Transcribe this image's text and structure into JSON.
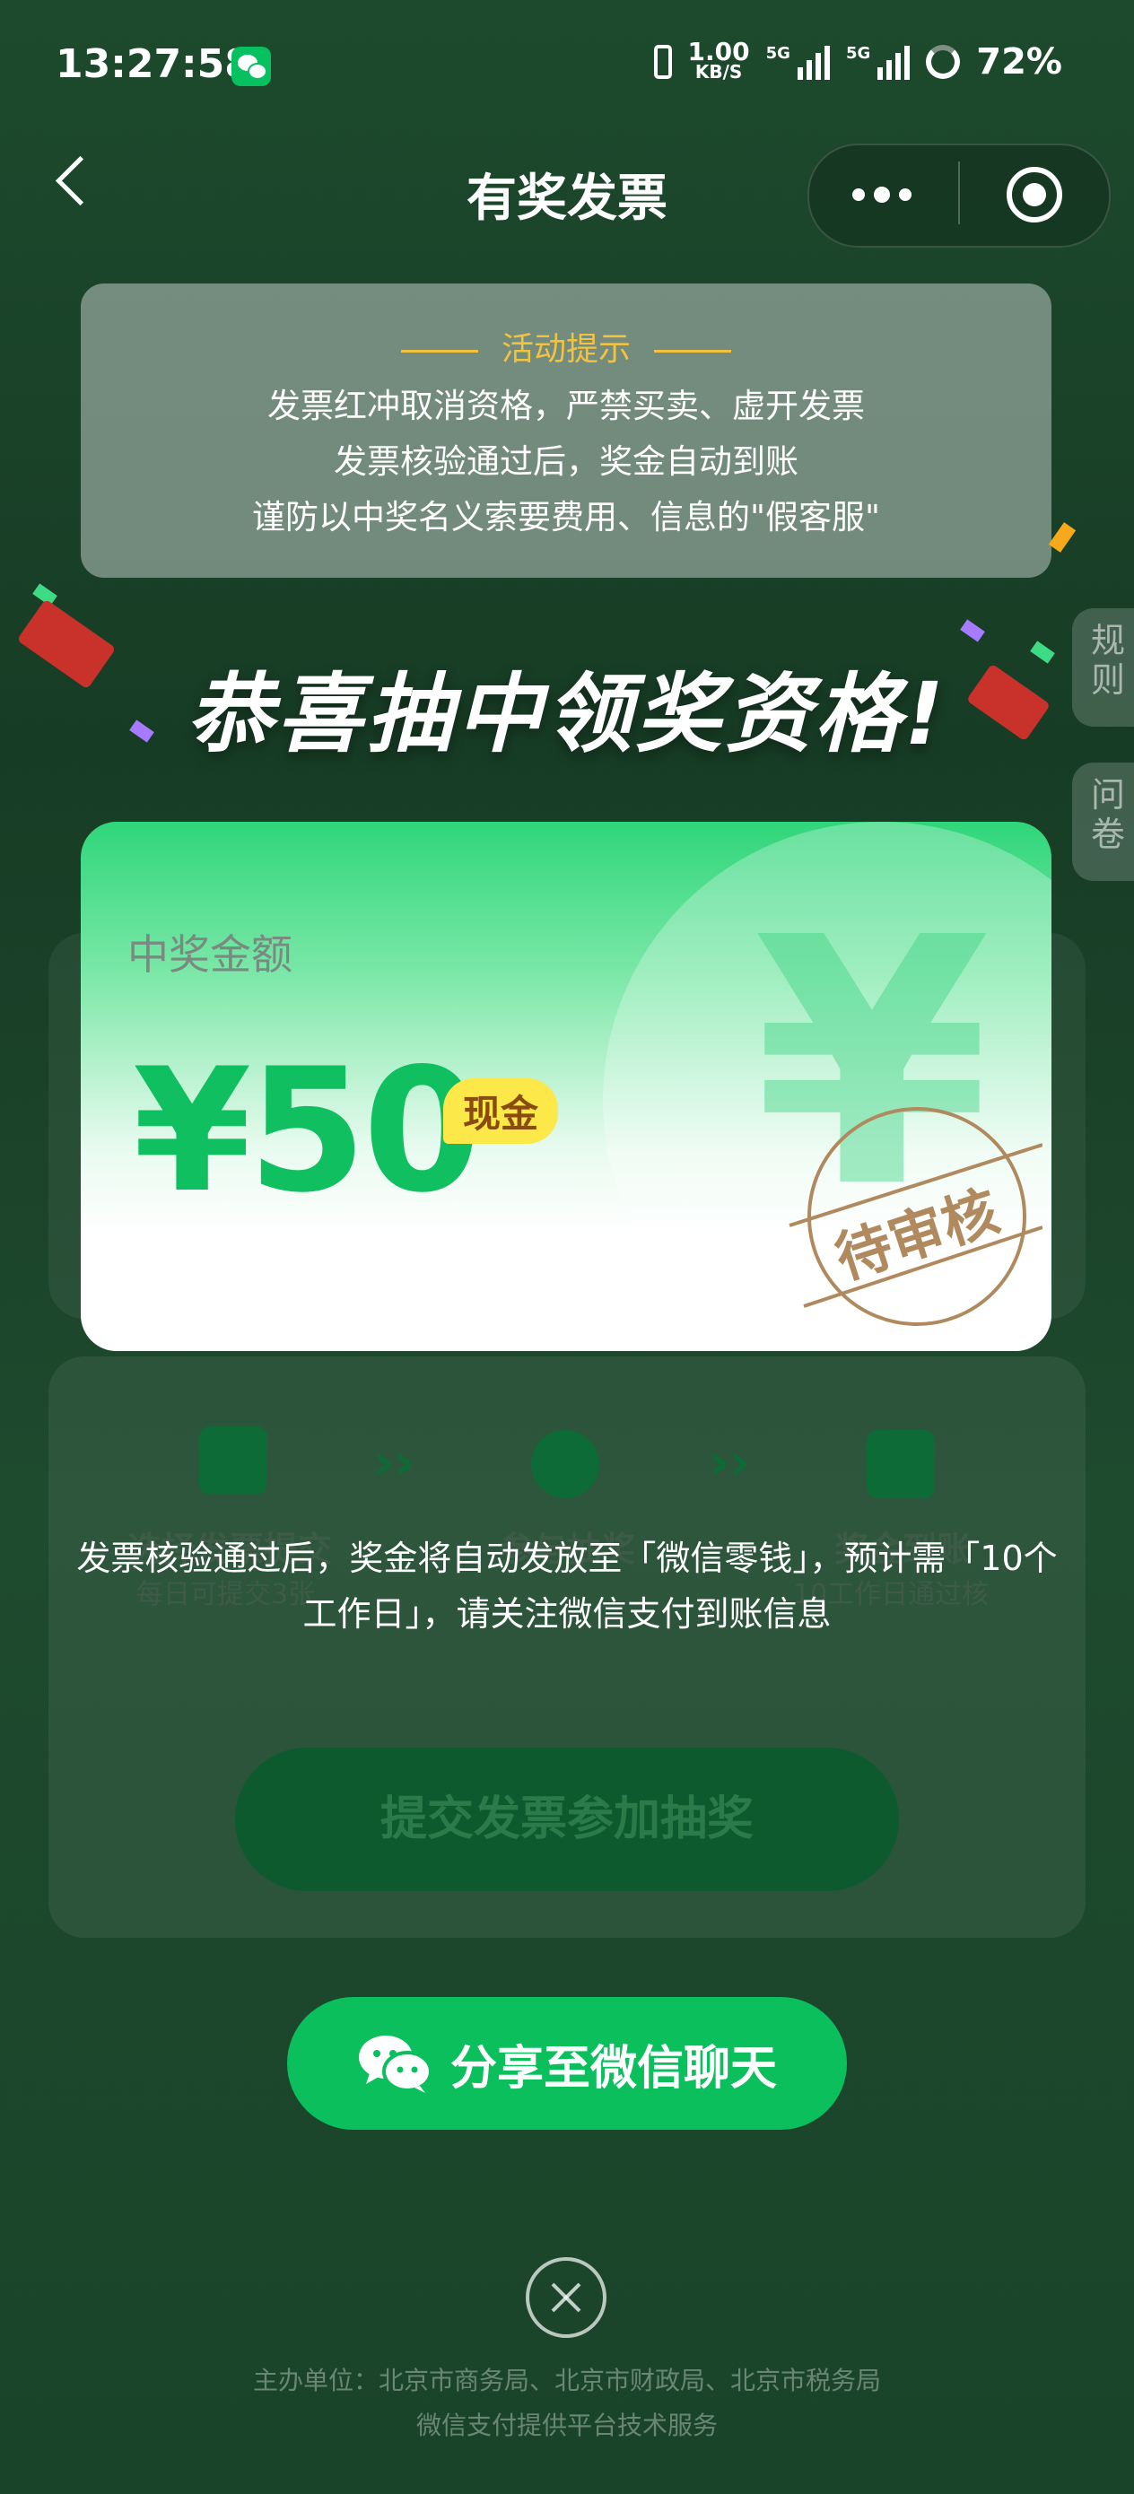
{
  "status_bar": {
    "time": "13:27:58",
    "net_rate_value": "1.00",
    "net_rate_unit": "KB/S",
    "signal_1": "5G",
    "signal_2": "5G",
    "battery": "72%"
  },
  "nav": {
    "title": "有奖发票"
  },
  "notice": {
    "heading": "活动提示",
    "lines": [
      "发票红冲取消资格，严禁买卖、虚开发票",
      "发票核验通过后，奖金自动到账",
      "谨防以中奖名义索要费用、信息的\"假客服\""
    ]
  },
  "side_tabs": [
    "规则",
    "问卷"
  ],
  "congrats": "恭喜抽中领奖资格!",
  "prize_card": {
    "label": "中奖金额",
    "amount": "¥50",
    "cash_tag": "现金",
    "stamp": "待审核",
    "bg_symbol": "¥"
  },
  "steps": [
    {
      "title": "选择发票提交",
      "sub": "每日可提交3张"
    },
    {
      "title": "参与抽奖",
      "sub": ""
    },
    {
      "title": "奖金到账",
      "sub": "10工作日通过核"
    }
  ],
  "toast": "发票核验通过后，奖金将自动发放至「微信零钱」，预计需「10个工作日」，请关注微信支付到账信息",
  "submit_button": "提交发票参加抽奖",
  "share_button": "分享至微信聊天",
  "footer": {
    "line1": "主办单位：北京市商务局、北京市财政局、北京市税务局",
    "line2": "微信支付提供平台技术服务"
  },
  "colors": {
    "accent": "#07c160",
    "prize_green": "#0fbf60",
    "notice_gold": "#f3c23e",
    "cash_tag_bg": "#fde84a",
    "stamp_brown": "#b08a5e"
  }
}
